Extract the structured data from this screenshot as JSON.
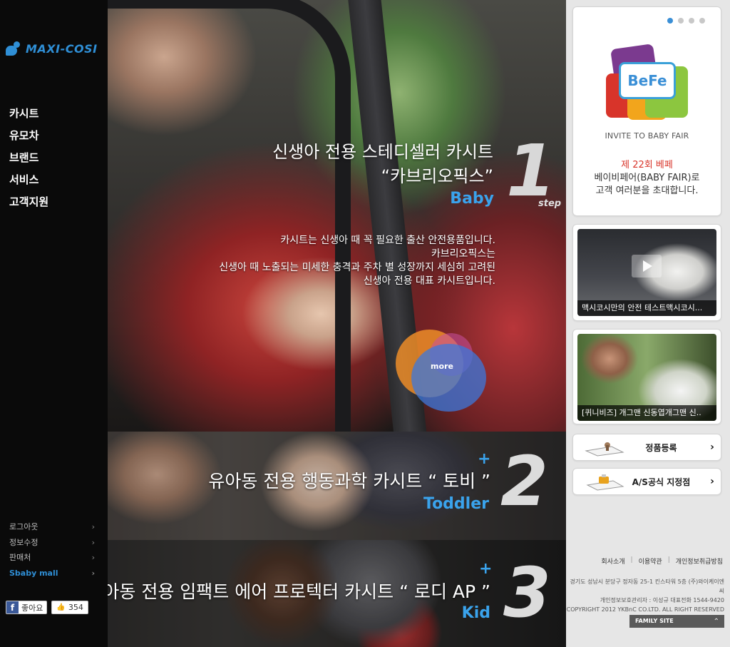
{
  "brand": {
    "logo_text": "MAXI-COSI"
  },
  "main_nav": [
    "카시트",
    "유모차",
    "브랜드",
    "서비스",
    "고객지원"
  ],
  "sub_nav": [
    {
      "label": "로그아웃",
      "highlight": false
    },
    {
      "label": "정보수정",
      "highlight": false
    },
    {
      "label": "판매처",
      "highlight": false
    },
    {
      "label": "Sbaby mall",
      "highlight": true
    }
  ],
  "sub_nav_chevron": "›",
  "facebook": {
    "like_label": "좋아요",
    "count": "354",
    "f_glyph": "f",
    "thumb_glyph": "👍"
  },
  "hero": {
    "title_line1": "신생아 전용 스테디셀러 카시트",
    "title_line2": "“카브리오픽스”",
    "category": "Baby",
    "step_number": "1",
    "step_label": "step",
    "desc_line1": "카시트는 신생아 때 꼭 필요한 출산 안전용품입니다.",
    "desc_line2": "카브리오픽스는",
    "desc_line3": "신생아 때 노출되는 미세한 충격과 주차 별 성장까지 세심히 고려된",
    "desc_line4": "신생아 전용 대표 카시트입니다.",
    "more_label": "more"
  },
  "steps": [
    {
      "title": "유아동 전용 행동과학 카시트 “ 토비 ”",
      "category": "Toddler",
      "number": "2",
      "plus": "+"
    },
    {
      "title": "아동 전용 임팩트 에어 프로텍터 카시트 “ 로디 AP ”",
      "category": "Kid",
      "number": "3",
      "plus": "+"
    }
  ],
  "right": {
    "banner": {
      "logo_text": "BeFe",
      "subtitle": "INVITE TO BABY FAIR",
      "line1": "제 22회 베페",
      "line2": "베이비페어(BABY FAIR)로",
      "line3": "고객 여러분을 초대합니다."
    },
    "videos": [
      {
        "caption": "맥시코시만의 안전 테스트맥시코시..."
      },
      {
        "caption": "[퀴니비즈] 개그맨 신동엽개그맨 신.."
      }
    ],
    "links": [
      {
        "label": "정품등록",
        "chevron": "›"
      },
      {
        "label": "A/S공식 지정점",
        "chevron": "›"
      }
    ],
    "footer_links": [
      "회사소개",
      "이용약관",
      "개인정보취급방침"
    ],
    "footer_sep": "|",
    "address_line1": "경기도 성남시 분당구 정자동 25-1 킨스타워 5층 (주)와이케이엔씨",
    "address_line2": "개인정보보호관리자 : 이성규  대표전화 1544-9420",
    "copyright": "COPYRIGHT 2012 YKBnC CO.LTD. ALL RIGHT RESERVED",
    "family_site": "FAMILY SITE"
  },
  "colors": {
    "accent": "#3aa3ec",
    "brand": "#2f8fd6",
    "banner_red": "#d9362b"
  }
}
